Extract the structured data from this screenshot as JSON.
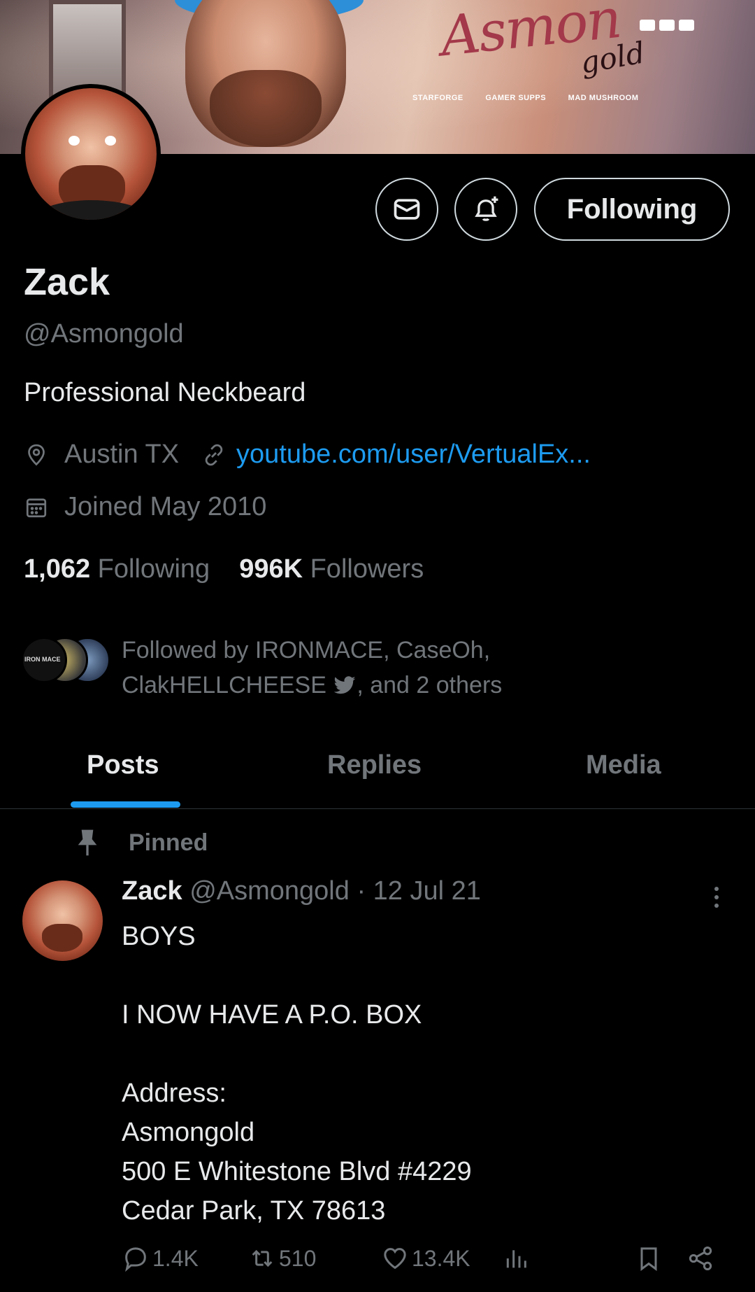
{
  "banner": {
    "logo_text": "Asmon",
    "logo_sub": "gold",
    "sponsors": [
      "STARFORGE",
      "GAMER SUPPS",
      "MAD MUSHROOM"
    ]
  },
  "header": {
    "message_icon": "envelope-icon",
    "notify_icon": "bell-plus-icon",
    "following_label": "Following"
  },
  "profile": {
    "name": "Zack",
    "handle": "@Asmongold",
    "bio": "Professional Neckbeard",
    "location": "Austin TX",
    "website": "youtube.com/user/VertualEx...",
    "joined": "Joined May 2010",
    "following_count": "1,062",
    "following_label": "Following",
    "followers_count": "996K",
    "followers_label": "Followers"
  },
  "followed_by": {
    "avatar1_label": "IRON MACE",
    "text_prefix": "Followed by IRONMACE, CaseOh,",
    "text_line2_a": "ClakHELLCHEESE",
    "text_line2_b": ", and 2 others"
  },
  "tabs": [
    {
      "label": "Posts",
      "active": true
    },
    {
      "label": "Replies",
      "active": false
    },
    {
      "label": "Media",
      "active": false
    }
  ],
  "post": {
    "pinned_label": "Pinned",
    "author_name": "Zack",
    "author_handle": "@Asmongold",
    "date": "· 12 Jul 21",
    "body": "BOYS\n\nI NOW HAVE A P.O. BOX\n\nAddress:\nAsmongold\n500 E Whitestone Blvd #4229\nCedar Park, TX 78613",
    "replies": "1.4K",
    "reposts": "510",
    "likes": "13.4K"
  },
  "colors": {
    "background": "#000000",
    "text_primary": "#e7e9ea",
    "text_secondary": "#71767b",
    "accent": "#1d9bf0",
    "border": "#2f3336"
  }
}
